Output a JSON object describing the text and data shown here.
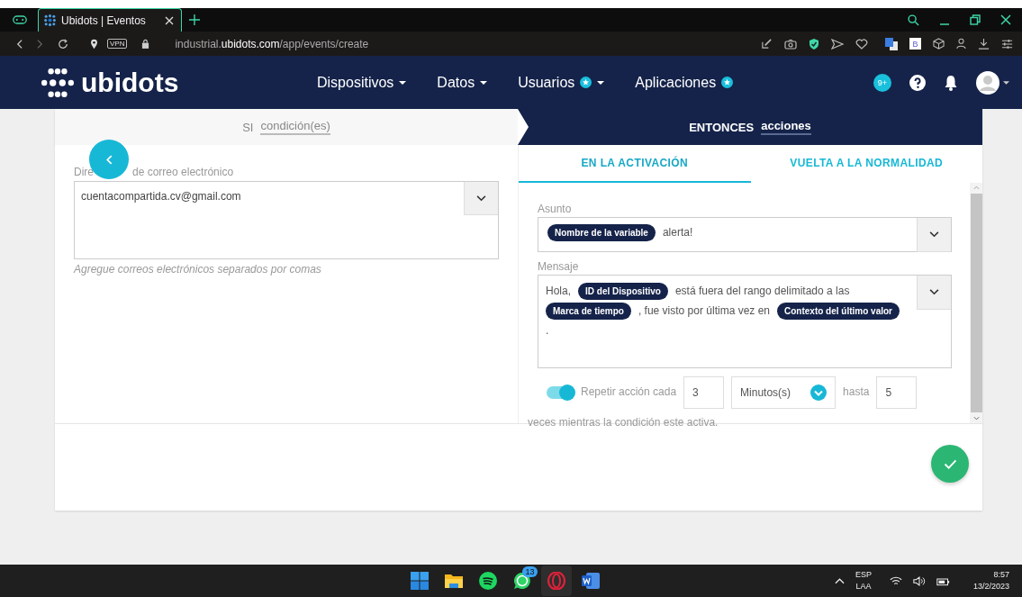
{
  "browser": {
    "tabs": [
      {
        "title": "Ubidots | Eventos",
        "selected": true
      }
    ],
    "vpn_badge": "VPN",
    "url": "industrial.**ubidots.com**/app/events/create",
    "extension_badge": "B"
  },
  "app_nav": {
    "logo": "ubidots",
    "menu": [
      {
        "label": "Dispositivos",
        "star": false,
        "dropdown": true
      },
      {
        "label": "Datos",
        "star": false,
        "dropdown": true
      },
      {
        "label": "Usuarios",
        "star": true,
        "dropdown": true
      },
      {
        "label": "Aplicaciones",
        "star": true,
        "dropdown": false
      }
    ],
    "notification_badge": "9+"
  },
  "steps": [
    {
      "prefix": "SI",
      "label": "condición(es)",
      "selected": false
    },
    {
      "prefix": "ENTONCES",
      "label": "acciones",
      "selected": true
    }
  ],
  "email": {
    "label_start": "Dire",
    "label_end": "de correo electrónico",
    "value": "cuentacompartida.cv@gmail.com",
    "hint": "Agregue correos electrónicos separados por comas"
  },
  "action_tabs": [
    {
      "label": "EN LA ACTIVACIÓN",
      "selected": true
    },
    {
      "label": "VUELTA A LA NORMALIDAD",
      "selected": false
    }
  ],
  "subject": {
    "label": "Asunto",
    "parts": [
      {
        "kind": "tag",
        "text": "Nombre de la variable"
      },
      {
        "kind": "text",
        "text": "alerta!"
      }
    ]
  },
  "message": {
    "label": "Mensaje",
    "lines": [
      [
        {
          "kind": "text",
          "text": "Hola,"
        },
        {
          "kind": "tag",
          "text": "ID del Dispositivo"
        },
        {
          "kind": "text",
          "text": "está fuera del rango delimitado a las"
        }
      ],
      [
        {
          "kind": "tag",
          "text": "Marca de tiempo"
        },
        {
          "kind": "text",
          "text": ", fue visto por última vez en"
        },
        {
          "kind": "tag",
          "text": "Contexto del último valor"
        }
      ],
      [
        {
          "kind": "text",
          "text": "."
        }
      ]
    ]
  },
  "repeat": {
    "on": true,
    "label": "Repetir acción cada",
    "count": "3",
    "unit": "Minutos(s)",
    "until_label": "hasta",
    "times": "5",
    "footer": "veces mientras la condición este activa."
  },
  "taskbar": {
    "apps": [
      {
        "kind": "start",
        "selected": false
      },
      {
        "kind": "files",
        "selected": false
      },
      {
        "kind": "spotify",
        "selected": false
      },
      {
        "kind": "whatsapp",
        "selected": false,
        "badge": "13"
      },
      {
        "kind": "opera",
        "selected": true
      },
      {
        "kind": "word",
        "selected": false
      }
    ],
    "language": "ESP",
    "layout": "LAA",
    "time": "8:57",
    "date": "13/2/2023"
  }
}
